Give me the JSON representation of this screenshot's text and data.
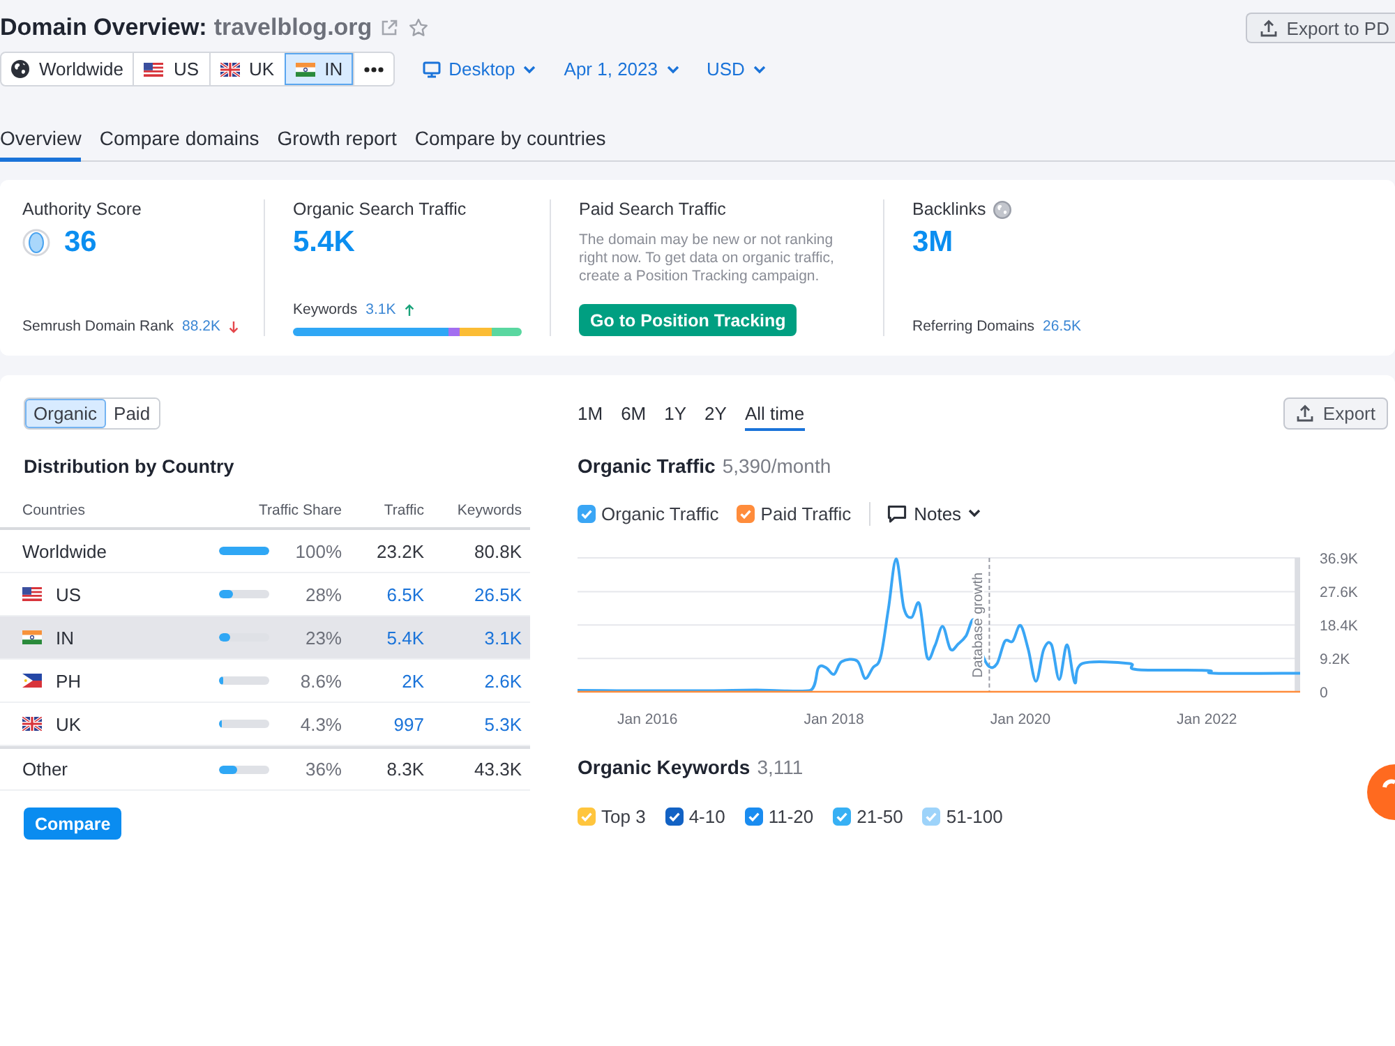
{
  "header": {
    "title": "Domain Overview:",
    "domain": "travelblog.org",
    "export_button": "Export to PD"
  },
  "locations": [
    {
      "kind": "worldwide",
      "label": "Worldwide",
      "selected": false
    },
    {
      "kind": "country",
      "label": "US",
      "selected": false
    },
    {
      "kind": "country",
      "label": "UK",
      "selected": false
    },
    {
      "kind": "country",
      "label": "IN",
      "selected": true
    }
  ],
  "filters": [
    {
      "kind": "device",
      "label": "Desktop"
    },
    {
      "kind": "date",
      "label": "Apr 1, 2023"
    },
    {
      "kind": "currency",
      "label": "USD"
    }
  ],
  "tabs": [
    {
      "label": "Overview",
      "selected": true
    },
    {
      "label": "Compare domains",
      "selected": false
    },
    {
      "label": "Growth report",
      "selected": false
    },
    {
      "label": "Compare by countries",
      "selected": false
    }
  ],
  "metrics": [
    {
      "kind": "score",
      "title": "Authority Score",
      "value": "36",
      "footer_label": "Semrush Domain Rank",
      "footer_value": "88.2K",
      "rising": false
    },
    {
      "kind": "traffic",
      "title": "Organic Search Traffic",
      "value": "5.4K",
      "footer_label": "Keywords",
      "footer_value": "3.1K",
      "rising": true
    },
    {
      "kind": "paid",
      "title": "Paid Search Traffic",
      "description": "The domain may be new or not ranking right now. To get data on organic traffic, create a Position Tracking campaign.",
      "button": "Go to Position Tracking"
    },
    {
      "kind": "backlinks",
      "title": "Backlinks",
      "value": "3M",
      "footer_label": "Referring Domains",
      "footer_value": "26.5K"
    }
  ],
  "distribution": {
    "toggle": [
      {
        "label": "Organic",
        "selected": true
      },
      {
        "label": "Paid",
        "selected": false
      }
    ],
    "title": "Distribution by Country",
    "columns": [
      "Countries",
      "Traffic Share",
      "Traffic",
      "Keywords"
    ],
    "rows": [
      {
        "kind": "summary",
        "country": "Worldwide",
        "level": 1,
        "share": "100%",
        "traffic": "23.2K",
        "keywords": "80.8K",
        "selected": false
      },
      {
        "kind": "country",
        "country": "US",
        "level": 0.28,
        "share": "28%",
        "traffic": "6.5K",
        "keywords": "26.5K",
        "selected": false
      },
      {
        "kind": "country",
        "country": "IN",
        "level": 0.23,
        "share": "23%",
        "traffic": "5.4K",
        "keywords": "3.1K",
        "selected": true
      },
      {
        "kind": "country",
        "country": "PH",
        "level": 0.086,
        "share": "8.6%",
        "traffic": "2K",
        "keywords": "2.6K",
        "selected": false
      },
      {
        "kind": "country",
        "country": "UK",
        "level": 0.043,
        "share": "4.3%",
        "traffic": "997",
        "keywords": "5.3K",
        "selected": false
      },
      {
        "kind": "summary",
        "country": "Other",
        "level": 0.36,
        "share": "36%",
        "traffic": "8.3K",
        "keywords": "43.3K",
        "selected": false
      }
    ],
    "compare_button": "Compare"
  },
  "traffic": {
    "periods": [
      {
        "label": "1M",
        "selected": false
      },
      {
        "label": "6M",
        "selected": false
      },
      {
        "label": "1Y",
        "selected": false
      },
      {
        "label": "2Y",
        "selected": false
      },
      {
        "label": "All time",
        "selected": true
      }
    ],
    "export_button": "Export",
    "title": "Organic Traffic",
    "summary": "5,390/month",
    "series_toggles": [
      {
        "checked": true
      },
      {
        "checked": true
      }
    ],
    "notes_button": "Notes",
    "chart_data": {
      "type": "line",
      "grid": true,
      "x": [
        "2015-04-01",
        "2015-09-01",
        "2016-03-01",
        "2016-09-01",
        "2017-03-01",
        "2017-06-01",
        "2017-10-01",
        "2017-11-01",
        "2017-12-01",
        "2018-01-01",
        "2018-02-01",
        "2018-04-01",
        "2018-05-01",
        "2018-06-01",
        "2018-07-01",
        "2018-08-01",
        "2018-09-01",
        "2018-10-01",
        "2018-11-01",
        "2018-12-01",
        "2019-01-01",
        "2019-02-01",
        "2019-03-01",
        "2019-04-01",
        "2019-05-01",
        "2019-06-01",
        "2019-07-01",
        "2019-08-01",
        "2019-09-01",
        "2019-10-01",
        "2019-11-01",
        "2019-12-01",
        "2020-01-01",
        "2020-02-01",
        "2020-03-01",
        "2020-04-01",
        "2020-05-01",
        "2020-06-01",
        "2020-07-01",
        "2020-08-01",
        "2020-09-01",
        "2021-03-01",
        "2021-04-01",
        "2022-01-01",
        "2022-02-01",
        "2023-01-01"
      ],
      "series": [
        {
          "name": "Organic Traffic",
          "color": "#3aa6f5",
          "values": [
            400,
            300,
            300,
            300,
            500,
            300,
            400,
            6600,
            6600,
            4800,
            8300,
            8500,
            3700,
            6600,
            9500,
            22700,
            36600,
            23100,
            20500,
            24200,
            9500,
            12700,
            18000,
            11700,
            13200,
            15400,
            19800,
            11000,
            6900,
            7800,
            13900,
            13900,
            18300,
            11700,
            2900,
            11700,
            12900,
            3400,
            12900,
            2500,
            7800,
            7800,
            6100,
            5900,
            5100,
            5100
          ]
        },
        {
          "name": "Paid Traffic",
          "color": "#ff8c3b",
          "x": [
            "2015-04-01",
            "2023-01-01"
          ],
          "values": [
            0,
            0
          ]
        }
      ],
      "xlim": [
        "2015-04-01",
        "2023-01-01"
      ],
      "ylim": [
        0,
        36900
      ],
      "xticks": [
        {
          "value": "2016-01-01",
          "label": "Jan 2016"
        },
        {
          "value": "2018-01-01",
          "label": "Jan 2018"
        },
        {
          "value": "2020-01-01",
          "label": "Jan 2020"
        },
        {
          "value": "2022-01-01",
          "label": "Jan 2022"
        }
      ],
      "yticks": [
        {
          "value": 0,
          "label": "0"
        },
        {
          "value": 9200,
          "label": "9.2K"
        },
        {
          "value": 18400,
          "label": "18.4K"
        },
        {
          "value": 27600,
          "label": "27.6K"
        },
        {
          "value": 36900,
          "label": "36.9K"
        }
      ],
      "ref_lines": [
        {
          "axis": "x",
          "value": "2019-09-01",
          "label": "Database growth",
          "line_style": "dashed",
          "color": "#9a9da6"
        }
      ],
      "bands": [
        {
          "axis": "x",
          "from": "2022-12-10",
          "to": "2023-01-01",
          "color": "#dcdee3"
        }
      ]
    }
  },
  "keywords": {
    "title": "Organic Keywords",
    "summary": "3,111",
    "filters": [
      {
        "label": "Top 3",
        "checked": true,
        "color": "#ffc53d"
      },
      {
        "label": "4-10",
        "checked": true,
        "color": "#1262c4"
      },
      {
        "label": "11-20",
        "checked": true,
        "color": "#1a8cf0"
      },
      {
        "label": "21-50",
        "checked": true,
        "color": "#37b0f4"
      },
      {
        "label": "51-100",
        "checked": true,
        "color": "#9dd3fa"
      }
    ]
  }
}
